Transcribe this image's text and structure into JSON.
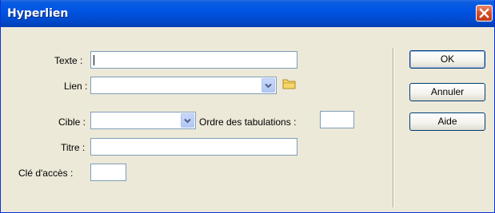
{
  "window": {
    "title": "Hyperlien"
  },
  "form": {
    "texte_label": "Texte :",
    "texte_value": "",
    "lien_label": "Lien :",
    "lien_value": "",
    "cible_label": "Cible :",
    "cible_value": "",
    "ordre_label": "Ordre des tabulations :",
    "ordre_value": "",
    "titre_label": "Titre :",
    "titre_value": "",
    "cle_label": "Clé d'accès :",
    "cle_value": ""
  },
  "buttons": {
    "ok": "OK",
    "annuler": "Annuler",
    "aide": "Aide"
  },
  "icons": {
    "close": "close-icon",
    "dropdown": "chevron-down-icon",
    "browse": "folder-icon"
  },
  "colors": {
    "titlebar": "#0054e3",
    "dialog_bg": "#ece9d8",
    "close": "#d34d2a"
  }
}
